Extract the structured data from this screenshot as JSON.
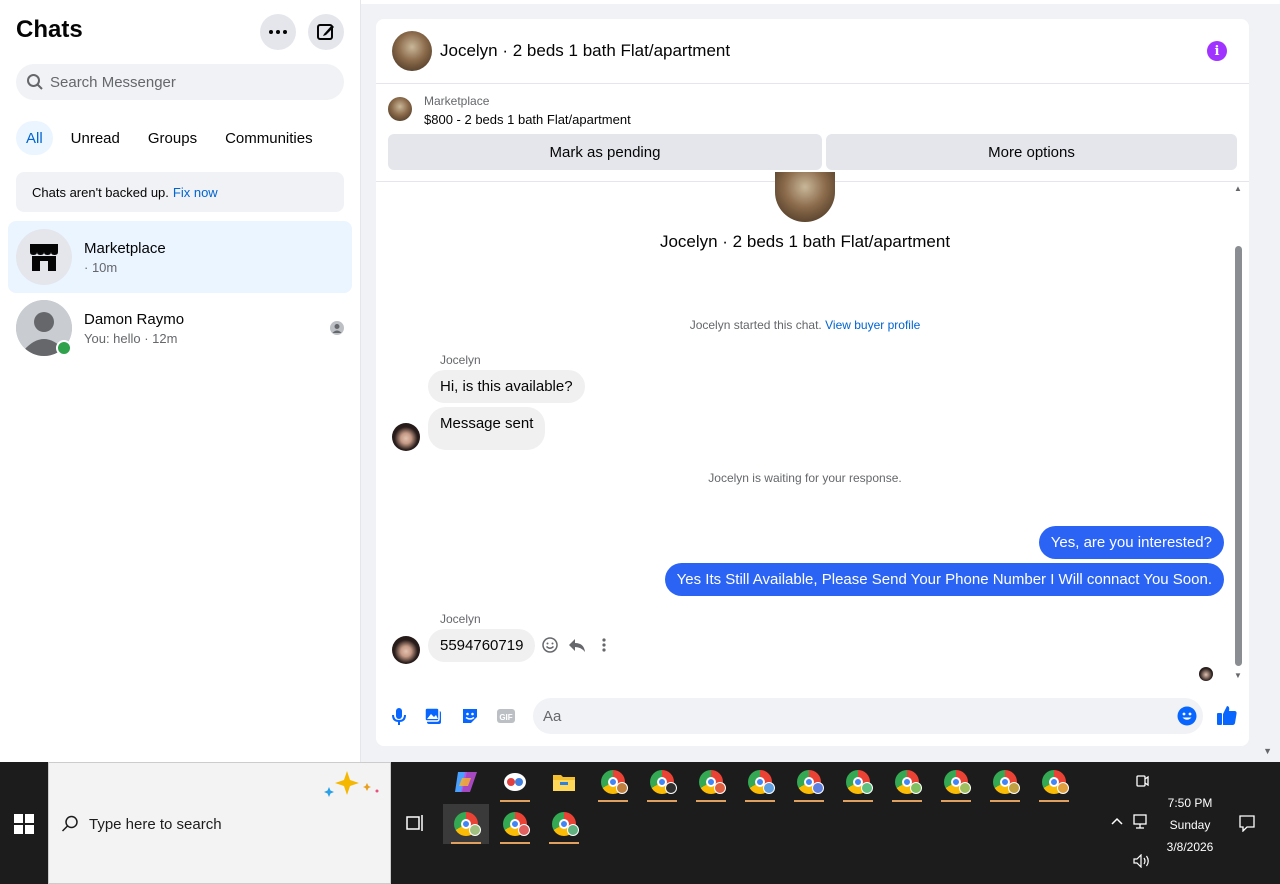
{
  "sidebar": {
    "title": "Chats",
    "search_placeholder": "Search Messenger",
    "filters": [
      "All",
      "Unread",
      "Groups",
      "Communities"
    ],
    "backup_text": "Chats aren't backed up.",
    "backup_link": "Fix now",
    "chats": [
      {
        "name": "Marketplace",
        "sub": "· 10m"
      },
      {
        "name": "Damon Raymo",
        "sub": "You: hello · 12m"
      }
    ]
  },
  "conversation": {
    "header_title": "Jocelyn · 2 beds 1 bath Flat/apartment",
    "marketplace_label": "Marketplace",
    "listing": "$800 - 2 beds 1 bath Flat/apartment",
    "mark_pending": "Mark as pending",
    "more_options": "More options",
    "intro_title": "Jocelyn · 2 beds 1 bath Flat/apartment",
    "started_text": "Jocelyn started this chat.",
    "buyer_profile_link": "View buyer profile",
    "sender_name": "Jocelyn",
    "msg1": "Hi, is this available?",
    "msg2": "Message sent",
    "waiting_text": "Jocelyn is waiting for your response.",
    "out1": "Yes, are you interested?",
    "out2": "Yes Its Still Available, Please Send Your Phone Number I Will connact You Soon.",
    "sender_name2": "Jocelyn",
    "msg3": "5594760719",
    "composer_placeholder": "Aa"
  },
  "taskbar": {
    "search_placeholder": "Type here to search",
    "time": "7:50 PM",
    "day": "Sunday",
    "date": "3/8/2026"
  }
}
